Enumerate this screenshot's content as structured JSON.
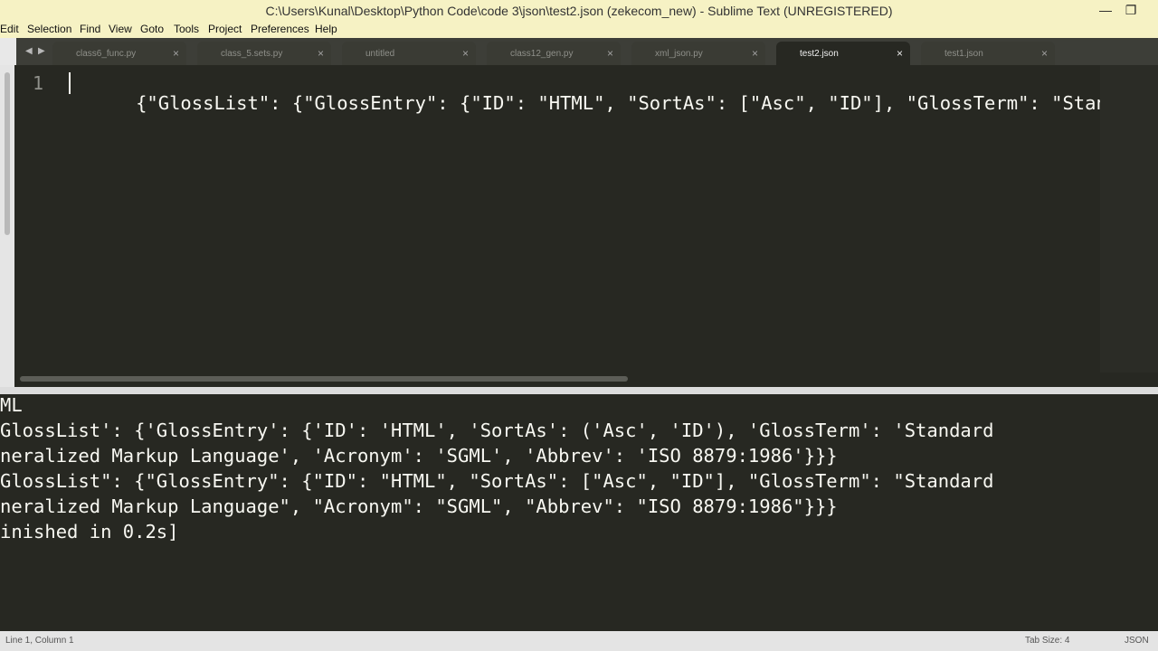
{
  "window": {
    "title": "C:\\Users\\Kunal\\Desktop\\Python Code\\code 3\\json\\test2.json (zekecom_new) - Sublime Text (UNREGISTERED)",
    "minimize_glyph": "—",
    "restore_glyph": "❐"
  },
  "menu": {
    "items": [
      "Edit",
      "Selection",
      "Find",
      "View",
      "Goto",
      "Tools",
      "Project",
      "Preferences",
      "Help"
    ]
  },
  "tabs": [
    {
      "label": "class6_func.py",
      "active": false
    },
    {
      "label": "class_5.sets.py",
      "active": false
    },
    {
      "label": "untitled",
      "active": false
    },
    {
      "label": "class12_gen.py",
      "active": false
    },
    {
      "label": "xml_json.py",
      "active": false
    },
    {
      "label": "test2.json",
      "active": true
    },
    {
      "label": "test1.json",
      "active": false
    }
  ],
  "tab_close_glyph": "×",
  "nav": {
    "back": "◀",
    "forward": "▶"
  },
  "editor": {
    "line_number": "1",
    "code": "{\"GlossList\": {\"GlossEntry\": {\"ID\": \"HTML\", \"SortAs\": [\"Asc\", \"ID\"], \"GlossTerm\": \"Standa"
  },
  "output": {
    "lines": [
      "ML",
      "GlossList': {'GlossEntry': {'ID': 'HTML', 'SortAs': ('Asc', 'ID'), 'GlossTerm': 'Standard",
      "neralized Markup Language', 'Acronym': 'SGML', 'Abbrev': 'ISO 8879:1986'}}}",
      "GlossList\": {\"GlossEntry\": {\"ID\": \"HTML\", \"SortAs\": [\"Asc\", \"ID\"], \"GlossTerm\": \"Standard",
      "neralized Markup Language\", \"Acronym\": \"SGML\", \"Abbrev\": \"ISO 8879:1986\"}}}",
      "inished in 0.2s]"
    ]
  },
  "status": {
    "position": "Line 1, Column 1",
    "tab_size": "Tab Size: 4",
    "syntax": "JSON"
  },
  "colors": {
    "title_bar": "#f6f2c4",
    "editor_bg": "#272822",
    "tab_bar": "#3d3e38",
    "text": "#f8f8f2",
    "gutter_text": "#8f908a"
  }
}
